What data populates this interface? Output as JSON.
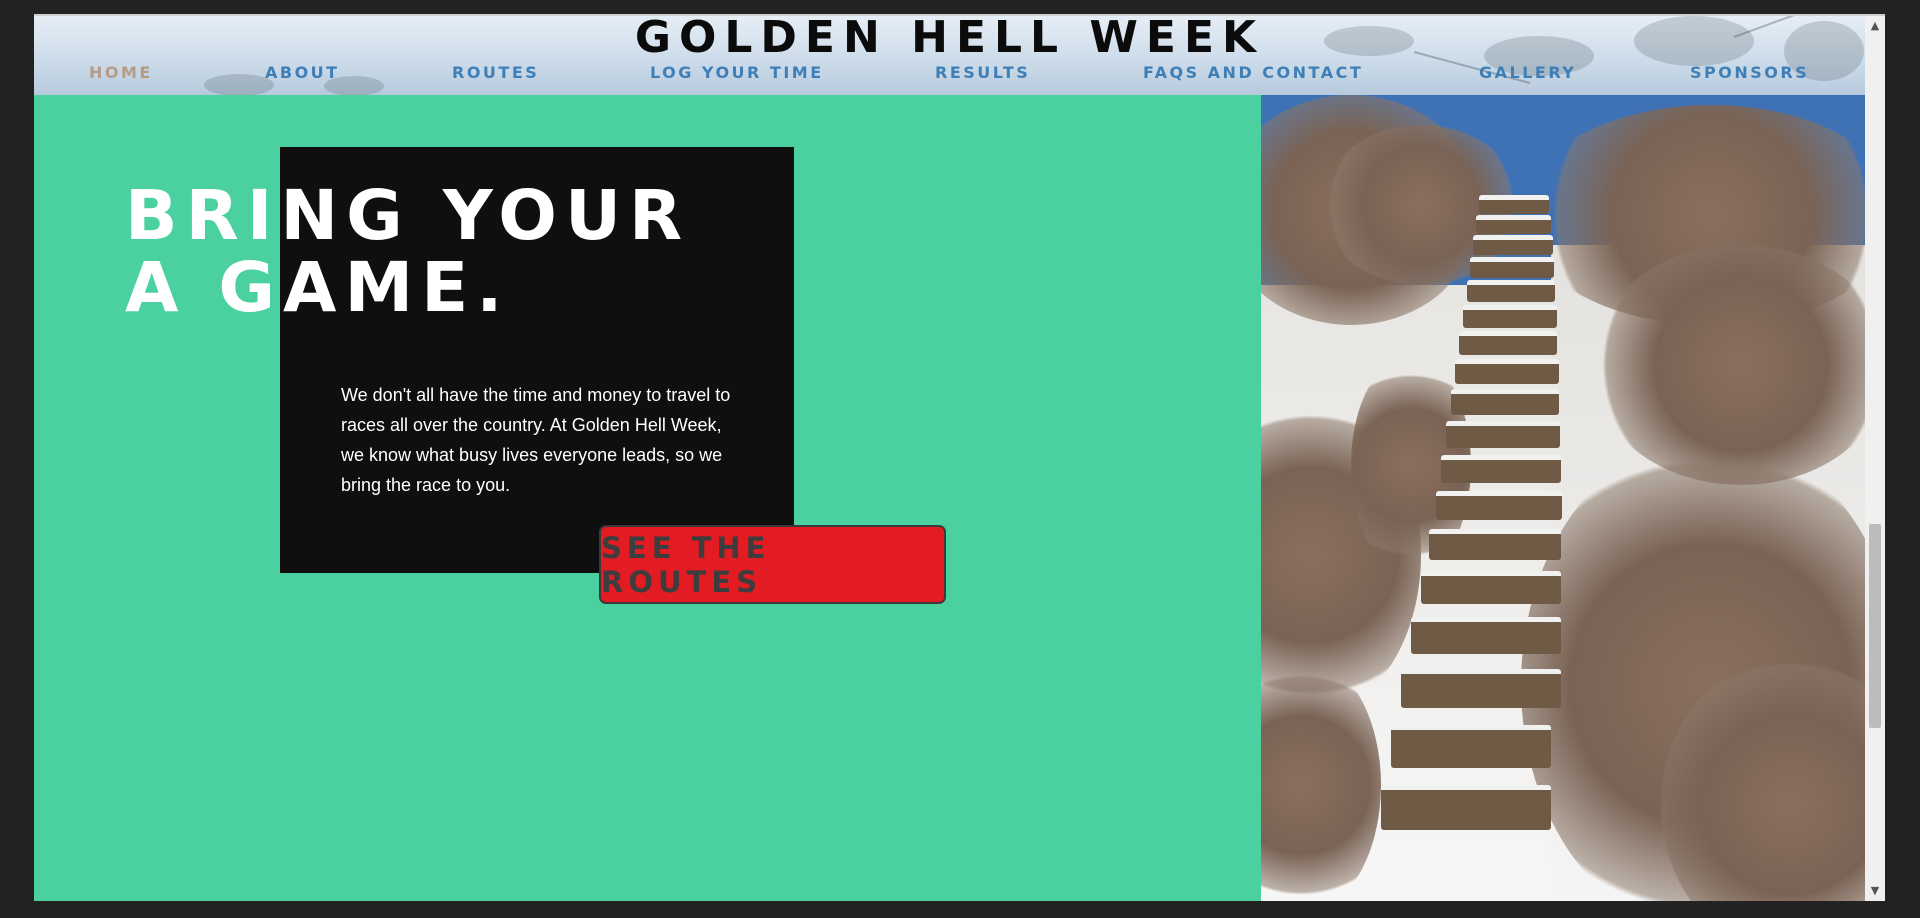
{
  "site": {
    "title": "GOLDEN HELL WEEK"
  },
  "nav": {
    "items": [
      {
        "label": "HOME",
        "active": true
      },
      {
        "label": "ABOUT"
      },
      {
        "label": "ROUTES"
      },
      {
        "label": "LOG YOUR TIME"
      },
      {
        "label": "RESULTS"
      },
      {
        "label": "FAQS AND CONTACT"
      },
      {
        "label": "GALLERY"
      },
      {
        "label": "SPONSORS"
      }
    ]
  },
  "hero": {
    "headline_line1": "BRING YOUR",
    "headline_line2": "A GAME.",
    "body": "We don't all have the time and money to travel to races all over the country. At Golden Hell Week, we know what busy lives everyone leads, so we bring the race to you.",
    "cta_label": "SEE THE ROUTES"
  },
  "colors": {
    "hero_background": "#4ad19f",
    "text_box": "#0f0f0f",
    "cta_background": "#e31b23",
    "nav_link": "#3f7fb8",
    "nav_active": "#b69b86"
  },
  "icons": {
    "scroll_up": "triangle-up-icon",
    "scroll_down": "triangle-down-icon"
  }
}
